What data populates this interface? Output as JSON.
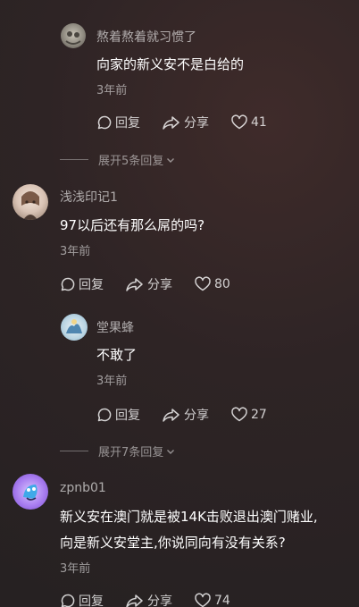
{
  "comments": [
    {
      "username": "熬着熬着就习惯了",
      "lines": [
        "向家的新义安不是白给的"
      ],
      "time": "3年前",
      "reply_label": "回复",
      "share_label": "分享",
      "likes": "41"
    },
    {
      "username": "浅浅印记1",
      "lines": [
        "97以后还有那么屌的吗?"
      ],
      "time": "3年前",
      "reply_label": "回复",
      "share_label": "分享",
      "likes": "80"
    },
    {
      "username": "堂果蜂",
      "lines": [
        "不敢了"
      ],
      "time": "3年前",
      "reply_label": "回复",
      "share_label": "分享",
      "likes": "27"
    },
    {
      "username": "zpnb01",
      "lines": [
        "新义安在澳门就是被14K击败退出澳门赌业,",
        "向是新义安堂主,你说同向有没有关系?"
      ],
      "time": "3年前",
      "reply_label": "回复",
      "share_label": "分享",
      "likes": "74"
    }
  ],
  "expand_replies": [
    {
      "label": "展开5条回复"
    },
    {
      "label": "展开7条回复"
    }
  ],
  "icons": {
    "reply": "comment-bubble-icon",
    "share": "share-arrow-icon",
    "like": "heart-icon",
    "expand": "chevron-down-icon"
  }
}
